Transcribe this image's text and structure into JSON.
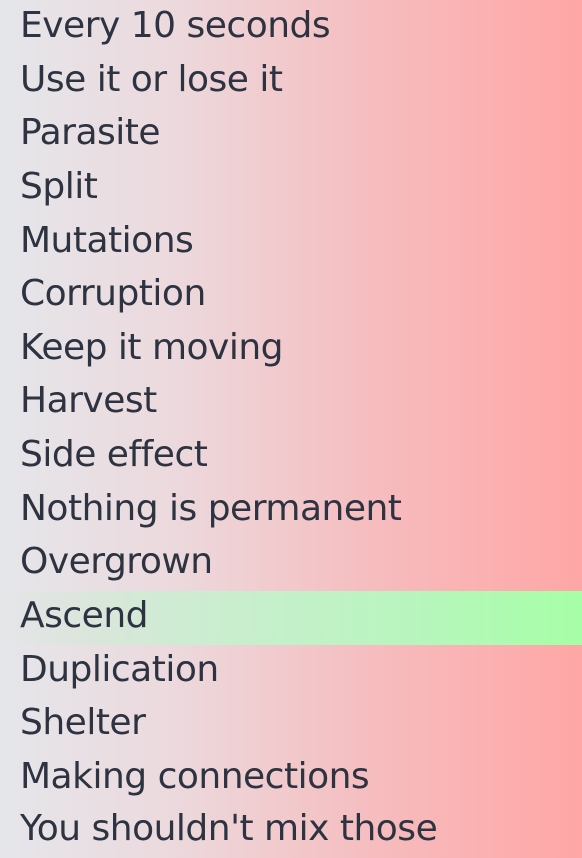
{
  "theme_list": {
    "selected_index": 11,
    "items": [
      {
        "label": "Every 10 seconds"
      },
      {
        "label": "Use it or lose it"
      },
      {
        "label": "Parasite"
      },
      {
        "label": "Split"
      },
      {
        "label": "Mutations"
      },
      {
        "label": "Corruption"
      },
      {
        "label": "Keep it moving"
      },
      {
        "label": "Harvest"
      },
      {
        "label": "Side effect"
      },
      {
        "label": "Nothing is permanent"
      },
      {
        "label": "Overgrown"
      },
      {
        "label": "Ascend"
      },
      {
        "label": "Duplication"
      },
      {
        "label": "Shelter"
      },
      {
        "label": "Making connections"
      },
      {
        "label": "You shouldn't mix those"
      }
    ]
  },
  "colors": {
    "text": "#2d3340",
    "background_left": "#e5e6ea",
    "background_right": "#ffa6a6",
    "selected_highlight": "#a6ffa6"
  }
}
